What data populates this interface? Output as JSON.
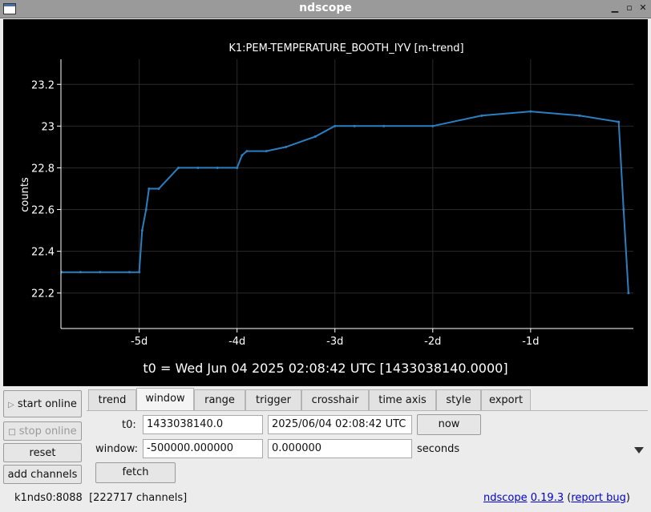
{
  "window": {
    "title": "ndscope",
    "controls": [
      "minimize-icon",
      "maximize-icon",
      "close-icon"
    ]
  },
  "plot": {
    "channel_title": "K1:PEM-TEMPERATURE_BOOTH_IYV [m-trend]",
    "t0_text": "t0 = Wed Jun 04 2025 02:08:42 UTC [1433038140.0000]",
    "colors": {
      "background": "#000000",
      "trace": "#2b7fc0",
      "grid": "#2a2a2a",
      "axis_text": "#ffffff"
    }
  },
  "chart_data": {
    "type": "line",
    "title": "K1:PEM-TEMPERATURE_BOOTH_IYV [m-trend]",
    "xlabel": "",
    "ylabel": "counts",
    "x_ticks": [
      "-5d",
      "-4d",
      "-3d",
      "-2d",
      "-1d"
    ],
    "y_ticks": [
      "22.2",
      "22.4",
      "22.6",
      "22.8",
      "23",
      "23.2"
    ],
    "xlim": [
      -5.8,
      0.05
    ],
    "ylim": [
      22.03,
      23.32
    ],
    "grid": true,
    "series": [
      {
        "color": "#2b7fc0",
        "x": [
          -5.79,
          -5.6,
          -5.4,
          -5.1,
          -5.0,
          -4.97,
          -4.93,
          -4.9,
          -4.8,
          -4.6,
          -4.4,
          -4.2,
          -4.0,
          -3.95,
          -3.9,
          -3.7,
          -3.5,
          -3.2,
          -3.0,
          -2.8,
          -2.5,
          -2.0,
          -1.5,
          -1.0,
          -0.5,
          -0.1,
          -0.05,
          0.0
        ],
        "y": [
          22.3,
          22.3,
          22.3,
          22.3,
          22.3,
          22.5,
          22.6,
          22.7,
          22.7,
          22.8,
          22.8,
          22.8,
          22.8,
          22.86,
          22.88,
          22.88,
          22.9,
          22.95,
          23.0,
          23.0,
          23.0,
          23.0,
          23.05,
          23.07,
          23.05,
          23.02,
          22.6,
          22.2
        ]
      }
    ]
  },
  "controls": {
    "start_online": "start online",
    "stop_online": "stop online",
    "reset": "reset",
    "add_channels": "add channels"
  },
  "tabs": [
    "trend",
    "window",
    "range",
    "trigger",
    "crosshair",
    "time axis",
    "style",
    "export"
  ],
  "active_tab": "window",
  "window_tab": {
    "t0_label": "t0:",
    "t0_gps": "1433038140.0",
    "t0_utc": "2025/06/04 02:08:42 UTC",
    "now_button": "now",
    "window_label": "window:",
    "window_start": "-500000.000000",
    "window_end": "0.000000",
    "window_units": "seconds",
    "fetch_button": "fetch"
  },
  "status": {
    "server": "k1nds0:8088",
    "channels": "[222717 channels]",
    "app_link": "ndscope",
    "version_link": "0.19.3",
    "report_bug": "report bug"
  }
}
